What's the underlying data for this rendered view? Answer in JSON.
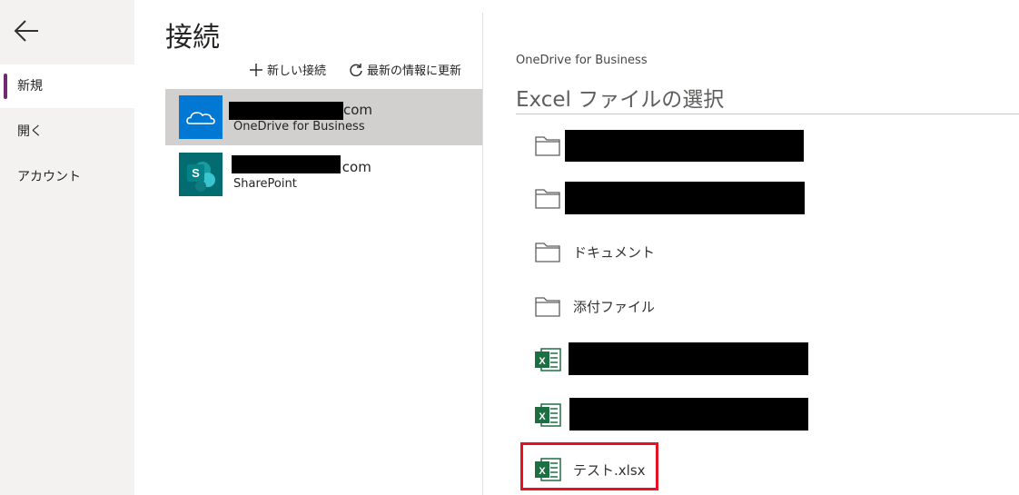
{
  "nav": {
    "back_icon": "arrow-left-icon",
    "items": [
      {
        "label": "新規",
        "active": true
      },
      {
        "label": "開く",
        "active": false
      },
      {
        "label": "アカウント",
        "active": false
      }
    ]
  },
  "connections": {
    "title": "接続",
    "new_connection_label": "新しい接続",
    "refresh_label": "最新の情報に更新",
    "items": [
      {
        "domain_suffix": "com",
        "service": "OneDrive for Business",
        "icon": "onedrive-icon",
        "selected": true
      },
      {
        "domain_suffix": ".com",
        "service": "SharePoint",
        "icon": "sharepoint-icon",
        "selected": false
      }
    ]
  },
  "file_picker": {
    "provider": "OneDrive for Business",
    "title": "Excel ファイルの選択",
    "files": [
      {
        "type": "folder",
        "name": ""
      },
      {
        "type": "folder",
        "name": ""
      },
      {
        "type": "folder",
        "name": "ドキュメント"
      },
      {
        "type": "folder",
        "name": "添付ファイル"
      },
      {
        "type": "excel",
        "name": ""
      },
      {
        "type": "excel",
        "name": ""
      },
      {
        "type": "excel",
        "name": "テスト.xlsx"
      }
    ]
  },
  "colors": {
    "accent": "#742774",
    "onedrive": "#0078d4",
    "sharepoint": "#036c70",
    "excel": "#1d6f42",
    "highlight": "#e81123"
  }
}
